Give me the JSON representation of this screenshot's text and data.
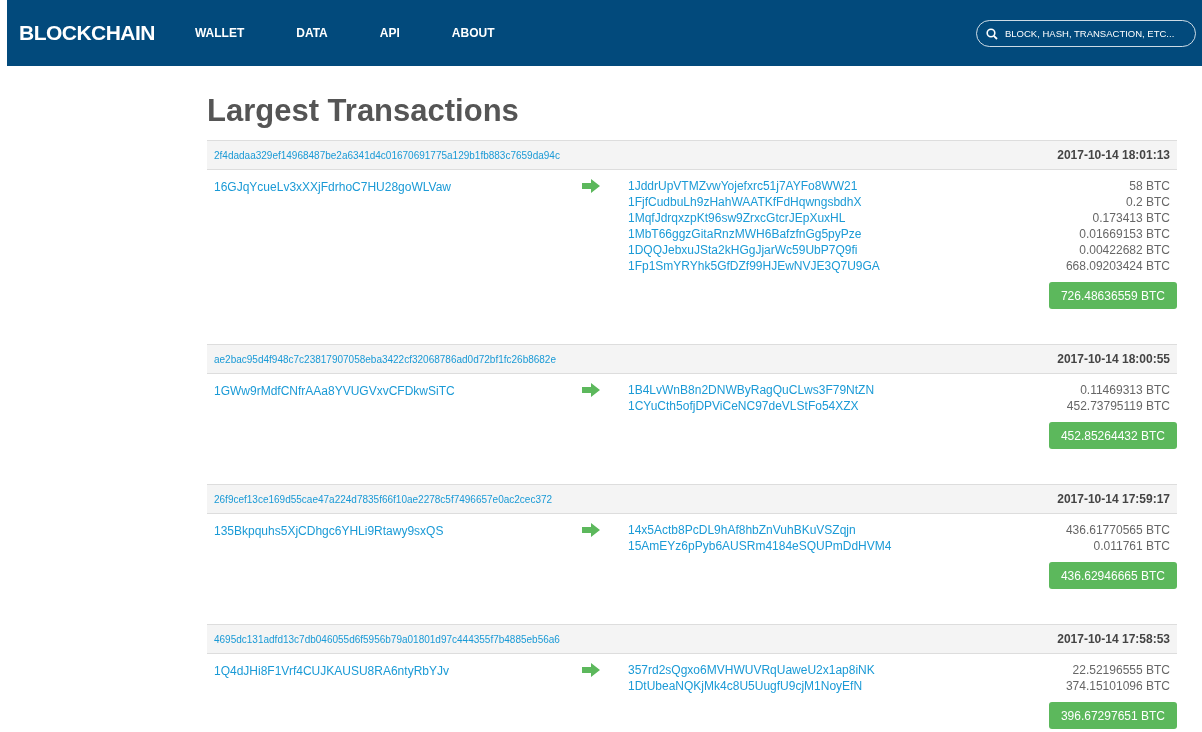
{
  "nav": {
    "logo": "BLOCKCHAIN",
    "links": [
      "WALLET",
      "DATA",
      "API",
      "ABOUT"
    ],
    "search": {
      "placeholder": "BLOCK, HASH, TRANSACTION, ETC..."
    }
  },
  "title": "Largest Transactions",
  "transactions": [
    {
      "hash": "2f4dadaa329ef14968487be2a6341d4c01670691775a129b1fb883c7659da94c",
      "time": "2017-10-14 18:01:13",
      "input": "16GJqYcueLv3xXXjFdrhoC7HU28goWLVaw",
      "outputs": [
        {
          "address": "1JddrUpVTMZvwYojefxrc51j7AYFo8WW21",
          "amount": "58 BTC"
        },
        {
          "address": "1FjfCudbuLh9zHahWAATKfFdHqwngsbdhX",
          "amount": "0.2 BTC"
        },
        {
          "address": "1MqfJdrqxzpKt96sw9ZrxcGtcrJEpXuxHL",
          "amount": "0.173413 BTC"
        },
        {
          "address": "1MbT66ggzGitaRnzMWH6BafzfnGg5pyPze",
          "amount": "0.01669153 BTC"
        },
        {
          "address": "1DQQJebxuJSta2kHGgJjarWc59UbP7Q9fi",
          "amount": "0.00422682 BTC"
        },
        {
          "address": "1Fp1SmYRYhk5GfDZf99HJEwNVJE3Q7U9GA",
          "amount": "668.09203424 BTC"
        }
      ],
      "total": "726.48636559 BTC"
    },
    {
      "hash": "ae2bac95d4f948c7c23817907058eba3422cf32068786ad0d72bf1fc26b8682e",
      "time": "2017-10-14 18:00:55",
      "input": "1GWw9rMdfCNfrAAa8YVUGVxvCFDkwSiTC",
      "outputs": [
        {
          "address": "1B4LvWnB8n2DNWByRagQuCLws3F79NtZN",
          "amount": "0.11469313 BTC"
        },
        {
          "address": "1CYuCth5ofjDPViCeNC97deVLStFo54XZX",
          "amount": "452.73795119 BTC"
        }
      ],
      "total": "452.85264432 BTC"
    },
    {
      "hash": "26f9cef13ce169d55cae47a224d7835f66f10ae2278c5f7496657e0ac2cec372",
      "time": "2017-10-14 17:59:17",
      "input": "135Bkpquhs5XjCDhgc6YHLi9Rtawy9sxQS",
      "outputs": [
        {
          "address": "14x5Actb8PcDL9hAf8hbZnVuhBKuVSZqjn",
          "amount": "436.61770565 BTC"
        },
        {
          "address": "15AmEYz6pPyb6AUSRm4184eSQUPmDdHVM4",
          "amount": "0.011761 BTC"
        }
      ],
      "total": "436.62946665 BTC"
    },
    {
      "hash": "4695dc131adfd13c7db046055d6f5956b79a01801d97c444355f7b4885eb56a6",
      "time": "2017-10-14 17:58:53",
      "input": "1Q4dJHi8F1Vrf4CUJKAUSU8RA6ntyRbYJv",
      "outputs": [
        {
          "address": "357rd2sQgxo6MVHWUVRqUaweU2x1ap8iNK",
          "amount": "22.52196555 BTC"
        },
        {
          "address": "1DtUbeaNQKjMk4c8U5UugfU9cjM1NoyEfN",
          "amount": "374.15101096 BTC"
        }
      ],
      "total": "396.67297651 BTC"
    }
  ]
}
